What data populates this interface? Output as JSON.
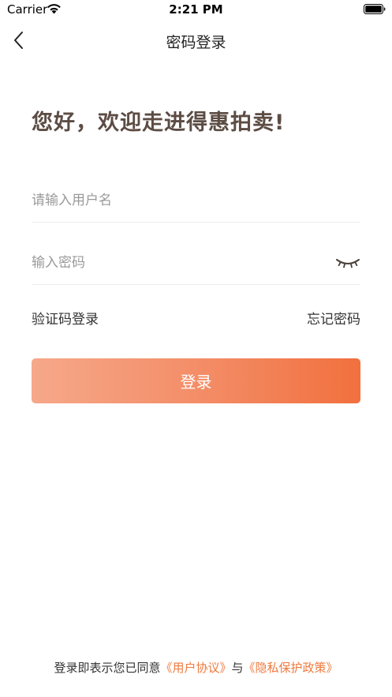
{
  "status_bar": {
    "carrier": "Carrier",
    "time": "2:21 PM",
    "icons": [
      "wifi-icon",
      "battery-icon"
    ]
  },
  "nav": {
    "back_icon": "chevron-left-icon",
    "title": "密码登录"
  },
  "greeting": "您好，欢迎走进得惠拍卖!",
  "form": {
    "username_placeholder": "请输入用户名",
    "username_value": "",
    "password_placeholder": "输入密码",
    "password_value": "",
    "password_toggle_icon": "eye-closed-icon"
  },
  "links": {
    "sms_login": "验证码登录",
    "forgot_password": "忘记密码"
  },
  "login_button": "登录",
  "agreement": {
    "prefix": "登录即表示您已同意",
    "user_agreement": "《用户协议》",
    "connector": "与",
    "privacy_policy": "《隐私保护政策》"
  },
  "colors": {
    "accent": "#f1703e",
    "gradient_start": "#f6a88a",
    "link": "#ee7a3e",
    "greeting_text": "#5c4c44"
  }
}
